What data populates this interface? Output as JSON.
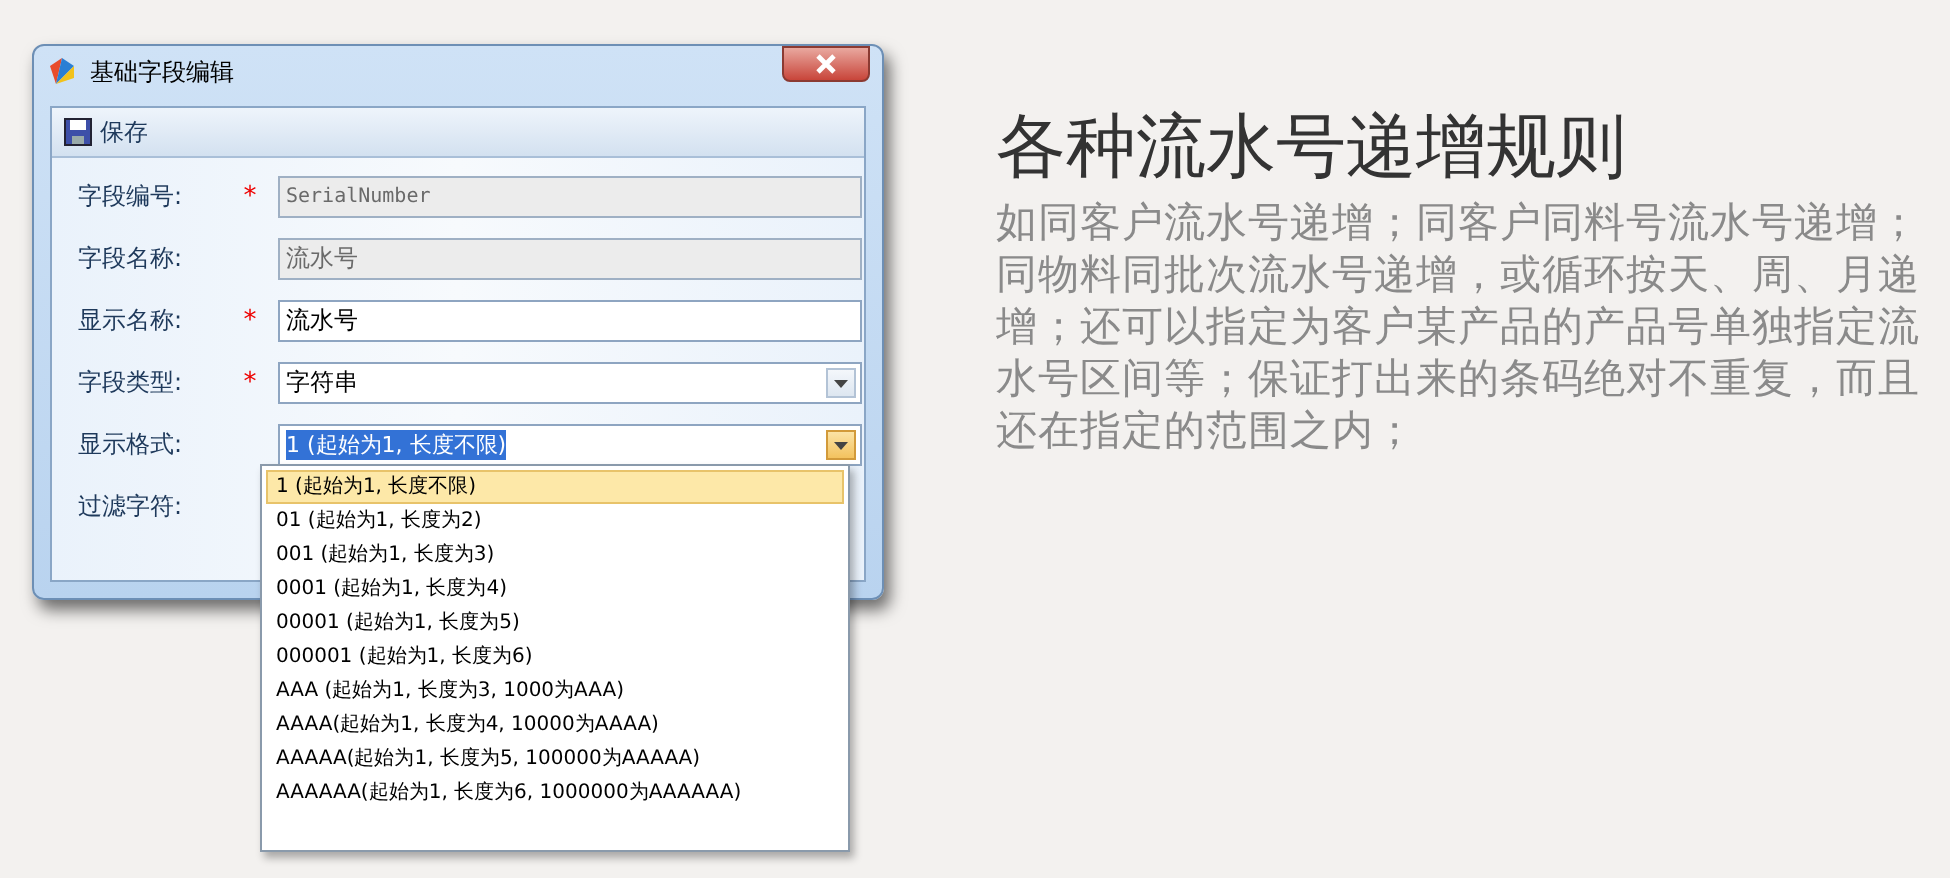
{
  "window": {
    "title": "基础字段编辑"
  },
  "toolbar": {
    "save_label": "保存"
  },
  "fields": [
    {
      "label": "字段编号:",
      "required_mark": "*",
      "kind": "text",
      "value": "SerialNumber",
      "disabled": true
    },
    {
      "label": "字段名称:",
      "kind": "text",
      "value": "流水号",
      "disabled": true
    },
    {
      "label": "显示名称:",
      "required_mark": "*",
      "kind": "text",
      "value": "流水号",
      "disabled": false
    },
    {
      "label": "字段类型:",
      "required_mark": "*",
      "kind": "combo",
      "value": "字符串"
    },
    {
      "label": "显示格式:",
      "kind": "combo_open",
      "value": "1 (起始为1, 长度不限)"
    },
    {
      "label": "过滤字符:",
      "kind": "blank"
    }
  ],
  "dropdown_options": [
    {
      "label": "1 (起始为1, 长度不限)",
      "selected": true
    },
    {
      "label": "01 (起始为1, 长度为2)",
      "selected": false
    },
    {
      "label": "001 (起始为1, 长度为3)",
      "selected": false
    },
    {
      "label": "0001 (起始为1, 长度为4)",
      "selected": false
    },
    {
      "label": "00001 (起始为1, 长度为5)",
      "selected": false
    },
    {
      "label": "000001 (起始为1, 长度为6)",
      "selected": false
    },
    {
      "label": "AAA (起始为1, 长度为3, 1000为AAA)",
      "selected": false
    },
    {
      "label": "AAAA(起始为1, 长度为4, 10000为AAAA)",
      "selected": false
    },
    {
      "label": "AAAAA(起始为1, 长度为5, 100000为AAAAA)",
      "selected": false
    },
    {
      "label": "AAAAAA(起始为1, 长度为6, 1000000为AAAAAA)",
      "selected": false
    }
  ],
  "feature": {
    "heading": "各种流水号递增规则",
    "description": "如同客户流水号递增；同客户同料号流水号递增；同物料同批次流水号递增，或循环按天、周、月递增；还可以指定为客户某产品的产品号单独指定流水号区间等；保证打出来的条码绝对不重复，而且还在指定的范围之内；"
  }
}
